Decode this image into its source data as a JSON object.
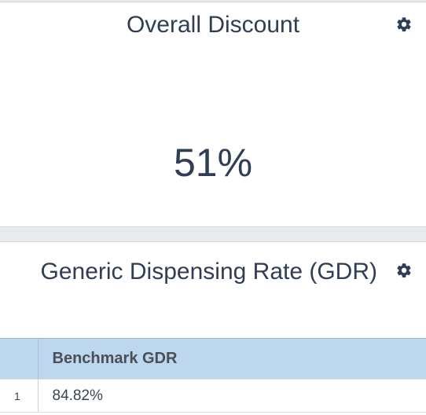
{
  "discount_panel": {
    "title": "Overall Discount",
    "value": "51%",
    "settings_icon": "gear-icon"
  },
  "gdr_panel": {
    "title": "Generic Dispensing Rate (GDR)",
    "settings_icon": "gear-icon",
    "table": {
      "columns": [
        "",
        "Benchmark GDR"
      ],
      "rows": [
        {
          "index": "1",
          "benchmark_gdr": "84.82%"
        }
      ]
    }
  },
  "colors": {
    "title_text": "#2f3e55",
    "header_bg": "#bcd7ee",
    "panel_bg": "#ffffff",
    "page_bg": "#e9eaec"
  }
}
